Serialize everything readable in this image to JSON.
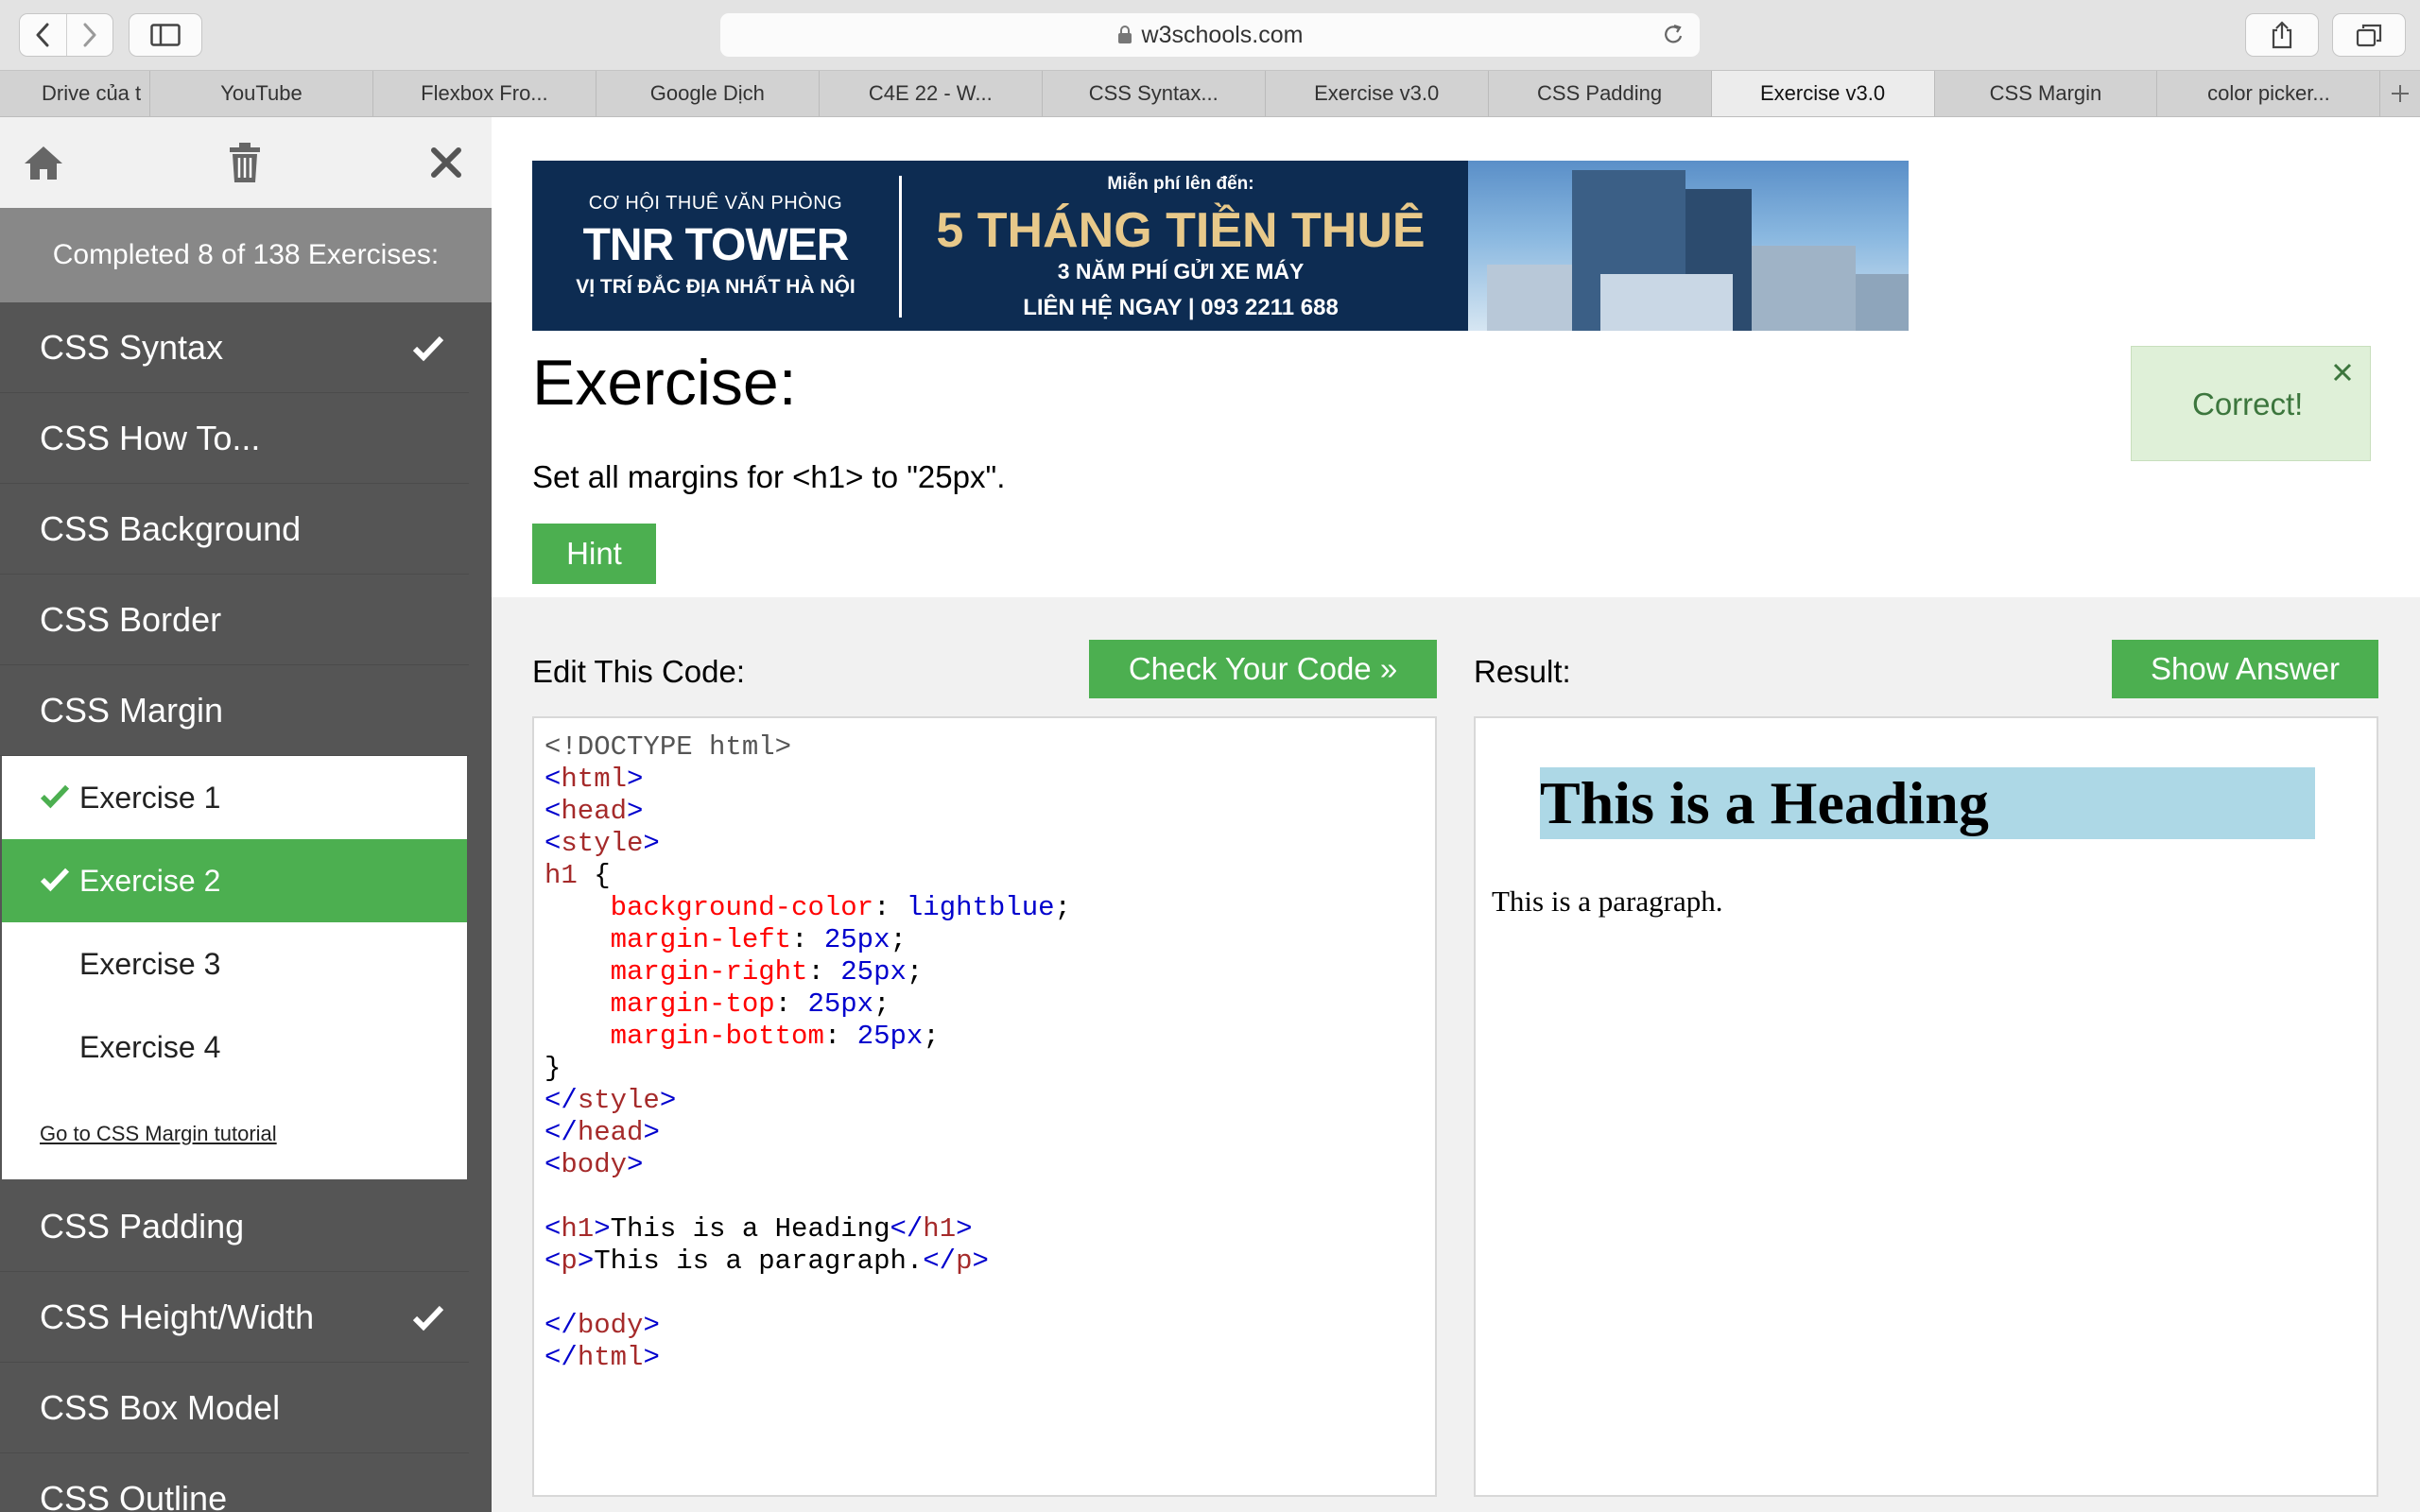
{
  "browser": {
    "url": "w3schools.com",
    "tabs": [
      {
        "label": "Drive của t"
      },
      {
        "label": "YouTube"
      },
      {
        "label": "Flexbox Fro..."
      },
      {
        "label": "Google Dịch"
      },
      {
        "label": "C4E 22 - W..."
      },
      {
        "label": "CSS Syntax..."
      },
      {
        "label": "Exercise v3.0"
      },
      {
        "label": "CSS Padding"
      },
      {
        "label": "Exercise v3.0"
      },
      {
        "label": "CSS Margin"
      },
      {
        "label": "color picker..."
      }
    ],
    "active_tab_index": 8
  },
  "sidebar": {
    "progress": "Completed 8 of 138 Exercises:",
    "items": [
      {
        "label": "CSS Syntax",
        "completed": true
      },
      {
        "label": "CSS How To...",
        "completed": false
      },
      {
        "label": "CSS Background",
        "completed": false
      },
      {
        "label": "CSS Border",
        "completed": false
      },
      {
        "label": "CSS Margin",
        "completed": false
      },
      {
        "label": "CSS Padding",
        "completed": false
      },
      {
        "label": "CSS Height/Width",
        "completed": true
      },
      {
        "label": "CSS Box Model",
        "completed": false
      },
      {
        "label": "CSS Outline",
        "completed": false
      }
    ],
    "submenu": {
      "items": [
        {
          "label": "Exercise 1",
          "completed": true
        },
        {
          "label": "Exercise 2",
          "completed": true,
          "active": true
        },
        {
          "label": "Exercise 3",
          "completed": false
        },
        {
          "label": "Exercise 4",
          "completed": false
        }
      ],
      "link": "Go to CSS Margin tutorial"
    }
  },
  "ad": {
    "left_line1": "CƠ HỘI THUÊ VĂN PHÒNG",
    "left_line2": "TNR TOWER",
    "left_line3": "VỊ TRÍ ĐẮC ĐỊA NHẤT HÀ NỘI",
    "mid_line1": "Miễn phí lên đến:",
    "mid_line2": "5 THÁNG TIỀN THUÊ",
    "mid_line3": "3 NĂM PHÍ GỬI XE MÁY",
    "mid_line4": "LIÊN HỆ NGAY  |  093 2211 688"
  },
  "exercise": {
    "title": "Exercise:",
    "instruction": "Set all margins for <h1> to \"25px\".",
    "hint": "Hint",
    "feedback": "Correct!"
  },
  "editor": {
    "label": "Edit This Code:",
    "check_button": "Check Your Code »",
    "result_label": "Result:",
    "answer_button": "Show Answer",
    "code": {
      "doctype": "<!DOCTYPE html>",
      "selector": "h1",
      "prop1": "background-color",
      "val1": "lightblue",
      "prop2": "margin-left",
      "val2": "25px",
      "prop3": "margin-right",
      "val3": "25px",
      "prop4": "margin-top",
      "val4": "25px",
      "prop5": "margin-bottom",
      "val5": "25px",
      "h1_text": "This is a Heading",
      "p_text": "This is a paragraph."
    }
  },
  "result": {
    "heading": "This is a Heading",
    "paragraph": "This is a paragraph."
  },
  "colors": {
    "accent_green": "#4caf50",
    "sidebar_bg": "#555555",
    "correct_bg": "#dff0d8",
    "heading_bg": "#add8e6"
  }
}
